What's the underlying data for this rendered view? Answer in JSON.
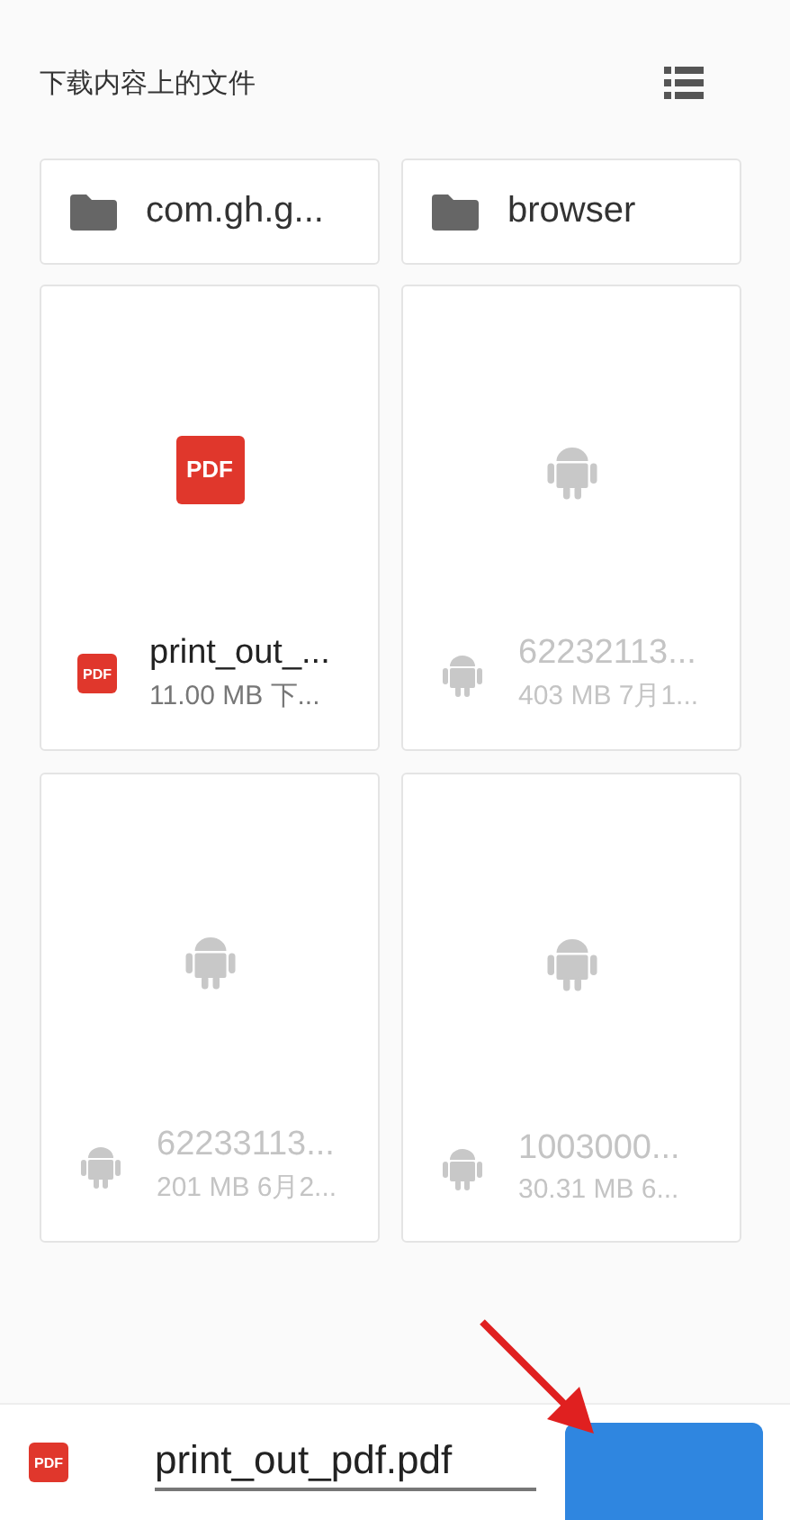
{
  "header": {
    "title": "下载内容上的文件"
  },
  "folders": [
    {
      "name": "com.gh.g..."
    },
    {
      "name": "browser"
    }
  ],
  "files": [
    {
      "kind": "pdf",
      "thumb_badge": "PDF",
      "badge": "PDF",
      "name": "print_out_...",
      "meta": "11.00 MB 下..."
    },
    {
      "kind": "apk",
      "name": "62232113...",
      "meta": "403 MB 7月1..."
    },
    {
      "kind": "apk",
      "name": "62233113...",
      "meta": "201 MB 6月2..."
    },
    {
      "kind": "apk",
      "name": "1003000...",
      "meta": "30.31 MB 6..."
    }
  ],
  "save_bar": {
    "badge": "PDF",
    "filename": "print_out_pdf.pdf"
  }
}
